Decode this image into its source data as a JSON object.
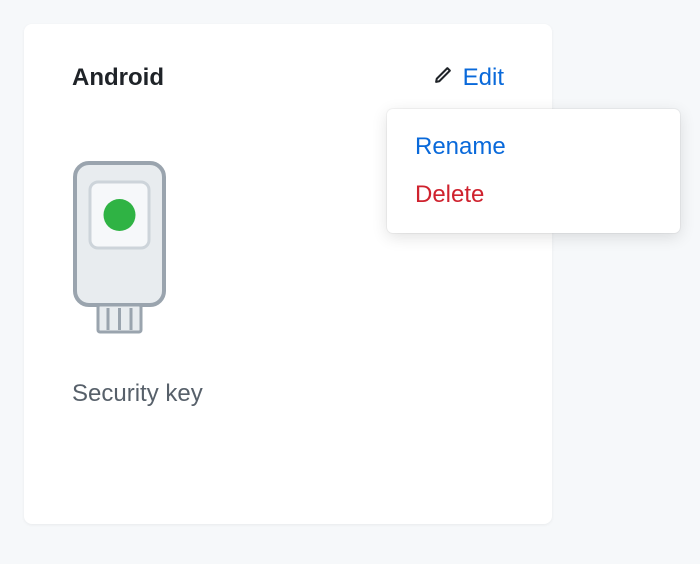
{
  "card": {
    "title": "Android",
    "subtitle": "Security key",
    "edit_label": "Edit"
  },
  "dropdown": {
    "rename_label": "Rename",
    "delete_label": "Delete"
  }
}
